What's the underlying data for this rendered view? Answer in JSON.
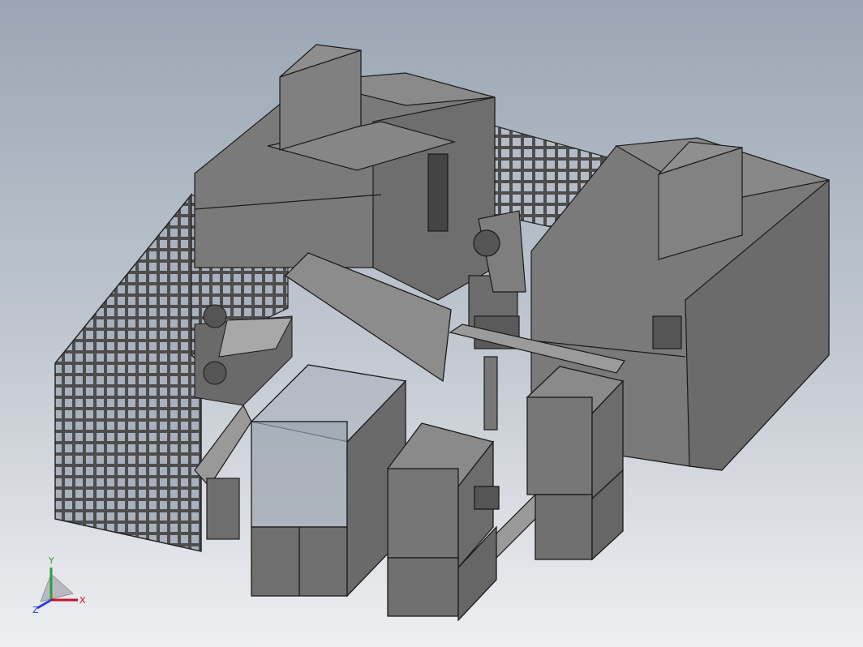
{
  "viewport": {
    "background_top": "#9aa6b4",
    "background_bottom": "#eeeff2",
    "model_color": "#7d7d7d",
    "model_edge_color": "#1a1a1a"
  },
  "triad": {
    "x_label": "X",
    "y_label": "Y",
    "z_label": "Z",
    "x_color": "#c8102e",
    "y_color": "#2e9e3a",
    "z_color": "#2a3fcf"
  }
}
